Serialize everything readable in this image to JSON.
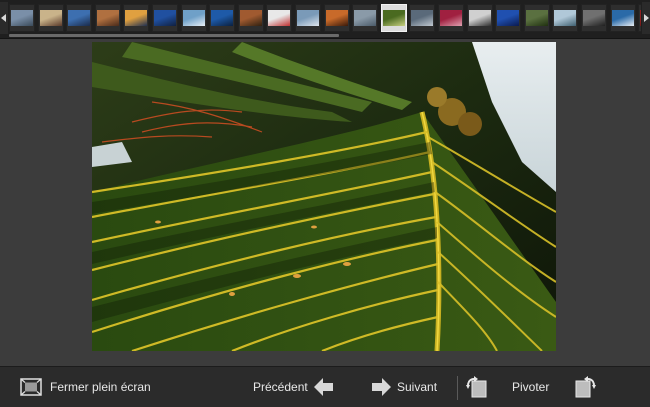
{
  "toolbar": {
    "exit_fullscreen_label": "Fermer plein écran",
    "previous_label": "Précédent",
    "next_label": "Suivant",
    "rotate_label": "Pivoter"
  },
  "filmstrip": {
    "thumbnails": [
      {
        "color": "#7a8fa8",
        "alt": "#3a4a5a"
      },
      {
        "color": "#c9b38a",
        "alt": "#5a3a2a"
      },
      {
        "color": "#3d6fb0",
        "alt": "#1a2a4a"
      },
      {
        "color": "#b07040",
        "alt": "#4a2a1a"
      },
      {
        "color": "#e0a040",
        "alt": "#203050"
      },
      {
        "color": "#2050a0",
        "alt": "#102040"
      },
      {
        "color": "#6fa0c8",
        "alt": "#e8f0f8"
      },
      {
        "color": "#1e5aa8",
        "alt": "#0a2040"
      },
      {
        "color": "#a05a30",
        "alt": "#302010"
      },
      {
        "color": "#e8e8e8",
        "alt": "#c03030"
      },
      {
        "color": "#7a9ab8",
        "alt": "#dfe6ee"
      },
      {
        "color": "#c86a2a",
        "alt": "#3a1a0a"
      },
      {
        "color": "#8a9aa8",
        "alt": "#4a5a68"
      },
      {
        "color": "#4a6a20",
        "alt": "#c8d080"
      },
      {
        "color": "#5a6a7a",
        "alt": "#c0c8d0"
      },
      {
        "color": "#a02040",
        "alt": "#e0a0b0"
      },
      {
        "color": "#d0d0d0",
        "alt": "#303030"
      },
      {
        "color": "#2050b0",
        "alt": "#0a1a50"
      },
      {
        "color": "#5a7040",
        "alt": "#203010"
      },
      {
        "color": "#b0c8d8",
        "alt": "#406070"
      },
      {
        "color": "#707070",
        "alt": "#202020"
      },
      {
        "color": "#2a6aa8",
        "alt": "#e8eef4"
      },
      {
        "color": "#902020",
        "alt": "#401010"
      }
    ],
    "selected_index": 13
  }
}
